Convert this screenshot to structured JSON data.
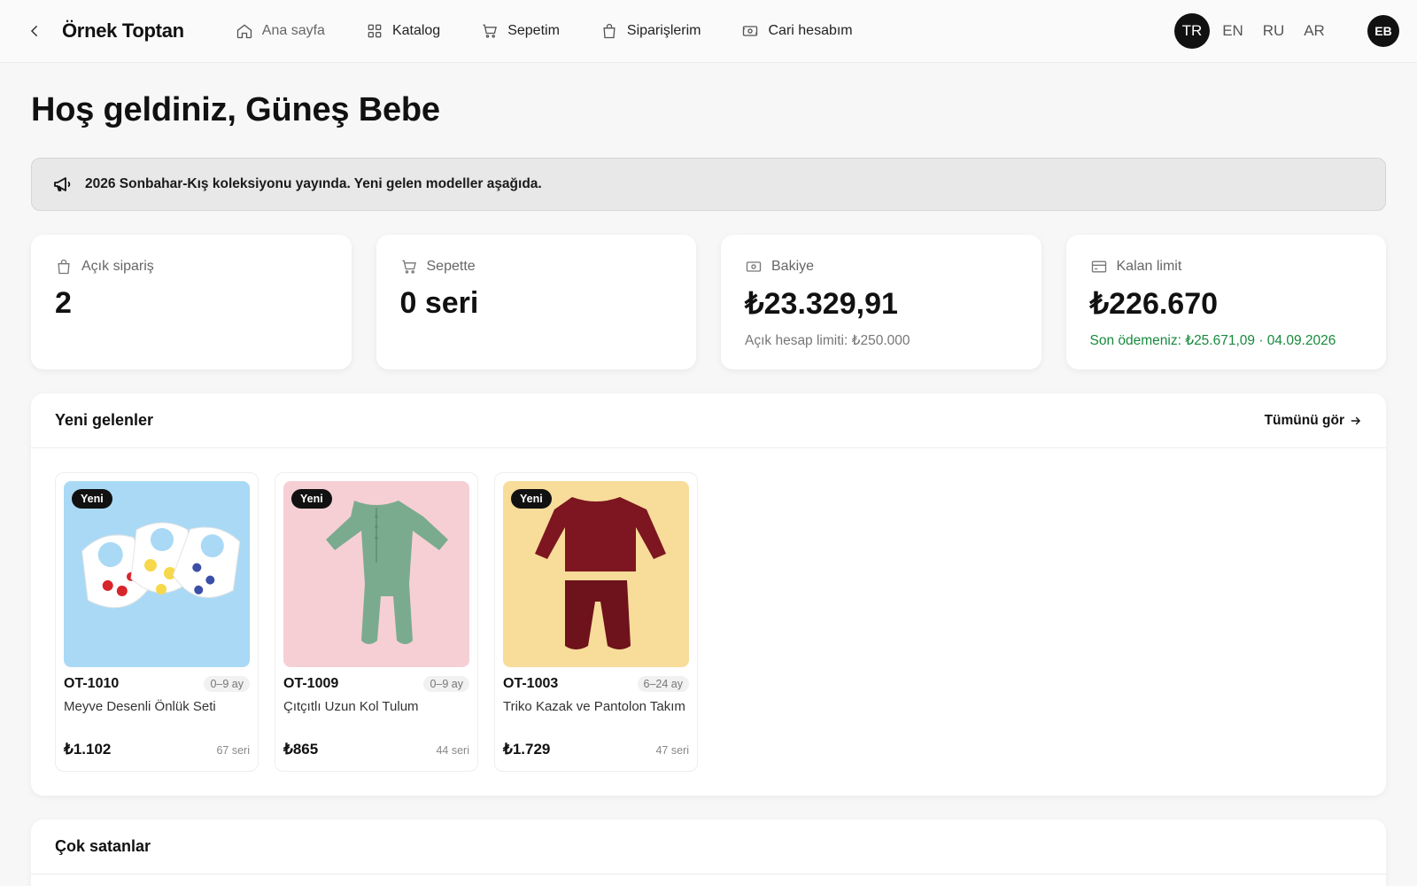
{
  "header": {
    "brand": "Örnek Toptan",
    "nav": [
      {
        "label": "Ana sayfa",
        "icon": "home-icon"
      },
      {
        "label": "Katalog",
        "icon": "grid-icon"
      },
      {
        "label": "Sepetim",
        "icon": "cart-icon"
      },
      {
        "label": "Siparişlerim",
        "icon": "bag-icon"
      },
      {
        "label": "Cari hesabım",
        "icon": "banknote-icon"
      }
    ],
    "languages": [
      "TR",
      "EN",
      "RU",
      "AR"
    ],
    "active_language": "TR",
    "avatar": "EB"
  },
  "welcome": "Hoş geldiniz, Güneş Bebe",
  "announcement": "2026 Sonbahar-Kış koleksiyonu yayında. Yeni gelen modeller aşağıda.",
  "stats": [
    {
      "label": "Açık sipariş",
      "value": "2",
      "sub": ""
    },
    {
      "label": "Sepette",
      "value": "0 seri",
      "sub": ""
    },
    {
      "label": "Bakiye",
      "value": "₺23.329,91",
      "sub": "Açık hesap limiti: ₺250.000"
    },
    {
      "label": "Kalan limit",
      "value": "₺226.670",
      "sub": "Son ödemeniz: ₺25.671,09 · 04.09.2026"
    }
  ],
  "new_arrivals": {
    "title": "Yeni gelenler",
    "see_all": "Tümünü gör",
    "products": [
      {
        "badge": "Yeni",
        "sku": "OT-1010",
        "age": "0–9 ay",
        "name": "Meyve Desenli Önlük Seti",
        "price": "₺1.102",
        "series": "67 seri"
      },
      {
        "badge": "Yeni",
        "sku": "OT-1009",
        "age": "0–9 ay",
        "name": "Çıtçıtlı Uzun Kol Tulum",
        "price": "₺865",
        "series": "44 seri"
      },
      {
        "badge": "Yeni",
        "sku": "OT-1003",
        "age": "6–24 ay",
        "name": "Triko Kazak ve Pantolon Takım",
        "price": "₺1.729",
        "series": "47 seri"
      }
    ]
  },
  "best_sellers": {
    "title": "Çok satanlar"
  },
  "colors": {
    "accent": "#111111",
    "success": "#178a3c",
    "banner_bg": "#e8e8e8"
  }
}
